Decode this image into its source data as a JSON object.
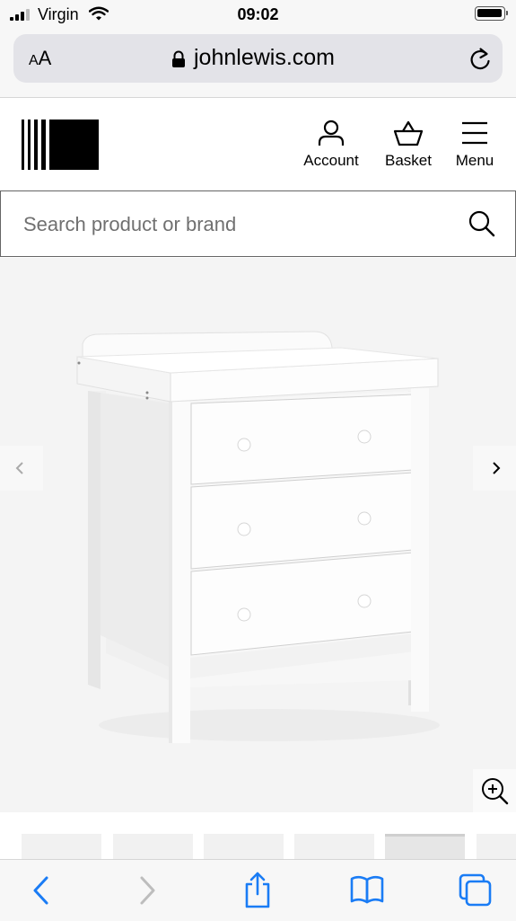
{
  "status_bar": {
    "carrier": "Virgin",
    "time": "09:02"
  },
  "browser": {
    "text_size_label_small": "A",
    "text_size_label_large": "A",
    "domain": "johnlewis.com"
  },
  "header": {
    "account_label": "Account",
    "basket_label": "Basket",
    "menu_label": "Menu"
  },
  "search": {
    "placeholder": "Search product or brand"
  },
  "product_image": {
    "subject": "white three-drawer changing unit"
  },
  "colors": {
    "brand": "#000000",
    "chrome": "#f7f7f7",
    "link_blue": "#1a7cf5"
  },
  "icons": [
    "signal-icon",
    "wifi-icon",
    "battery-icon",
    "lock-icon",
    "reload-icon",
    "account-icon",
    "basket-icon",
    "menu-icon",
    "search-icon",
    "chevron-left-icon",
    "chevron-right-icon",
    "zoom-in-icon",
    "back-icon",
    "forward-icon",
    "share-icon",
    "bookmarks-icon",
    "tabs-icon"
  ]
}
